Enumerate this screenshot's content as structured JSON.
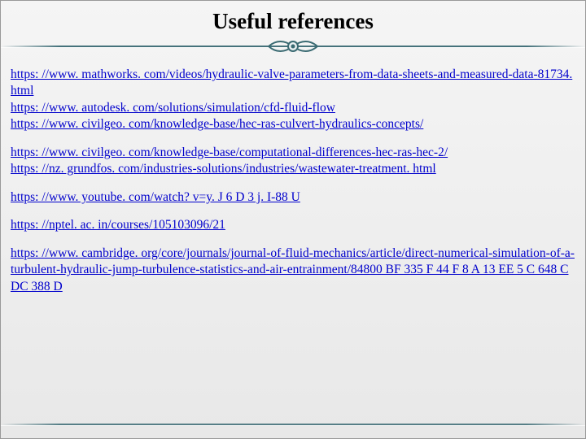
{
  "title": "Useful references",
  "references": [
    {
      "items": [
        "https: //www. mathworks. com/videos/hydraulic-valve-parameters-from-data-sheets-and-measured-data-81734. html",
        "https: //www. autodesk. com/solutions/simulation/cfd-fluid-flow",
        "https: //www. civilgeo. com/knowledge-base/hec-ras-culvert-hydraulics-concepts/"
      ]
    },
    {
      "items": [
        "https: //www. civilgeo. com/knowledge-base/computational-differences-hec-ras-hec-2/",
        "https: //nz. grundfos. com/industries-solutions/industries/wastewater-treatment. html"
      ]
    },
    {
      "items": [
        "https: //www. youtube. com/watch? v=y. J 6 D 3 j. I-88 U"
      ]
    },
    {
      "items": [
        "https: //nptel. ac. in/courses/105103096/21"
      ]
    },
    {
      "items": [
        "https: //www. cambridge. org/core/journals/journal-of-fluid-mechanics/article/direct-numerical-simulation-of-a-turbulent-hydraulic-jump-turbulence-statistics-and-air-entrainment/84800 BF 335 F 44 F 8 A 13 EE 5 C 648 CDC 388 D"
      ]
    }
  ]
}
